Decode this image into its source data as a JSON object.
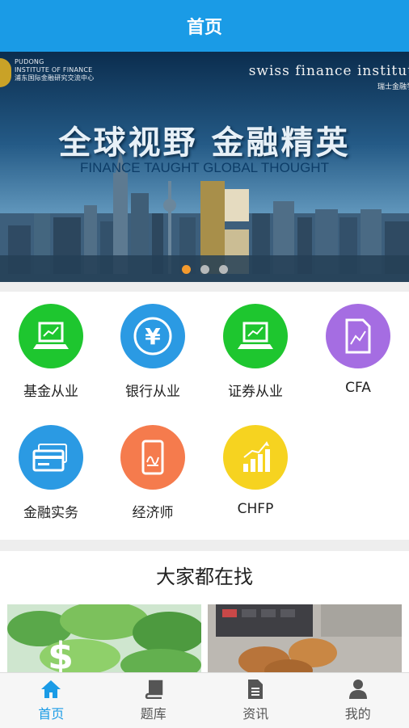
{
  "header": {
    "title": "首页"
  },
  "banner": {
    "logo_left_lines": [
      "PUDONG",
      "INSTITUTE OF FINANCE",
      "浦东国际金融研究交流中心"
    ],
    "logo_right": "swiss finance institut",
    "logo_right_sub": "瑞士金融学",
    "slogan_cn": "全球视野  金融精英",
    "slogan_en": "FINANCE TAUGHT GLOBAL THOUGHT",
    "slides": 3,
    "active_slide": 1
  },
  "categories": [
    {
      "label": "基金从业",
      "icon": "laptop-chart-icon",
      "color": "#1ec62f"
    },
    {
      "label": "银行从业",
      "icon": "yen-icon",
      "color": "#2b9ae3"
    },
    {
      "label": "证券从业",
      "icon": "laptop-chart-icon",
      "color": "#1ec62f"
    },
    {
      "label": "CFA",
      "icon": "document-chart-icon",
      "color": "#a56de2"
    },
    {
      "label": "金融实务",
      "icon": "credit-card-icon",
      "color": "#2b9ae3"
    },
    {
      "label": "经济师",
      "icon": "phone-signature-icon",
      "color": "#f57b4d"
    },
    {
      "label": "CHFP",
      "icon": "bar-growth-icon",
      "color": "#f6d320"
    }
  ],
  "section": {
    "title": "大家都在找"
  },
  "tabbar": {
    "items": [
      {
        "label": "首页",
        "icon": "home-icon",
        "active": true
      },
      {
        "label": "题库",
        "icon": "book-icon",
        "active": false
      },
      {
        "label": "资讯",
        "icon": "document-icon",
        "active": false
      },
      {
        "label": "我的",
        "icon": "user-icon",
        "active": false
      }
    ]
  },
  "colors": {
    "accent": "#1a9be6",
    "divider": "#eeeeee"
  }
}
